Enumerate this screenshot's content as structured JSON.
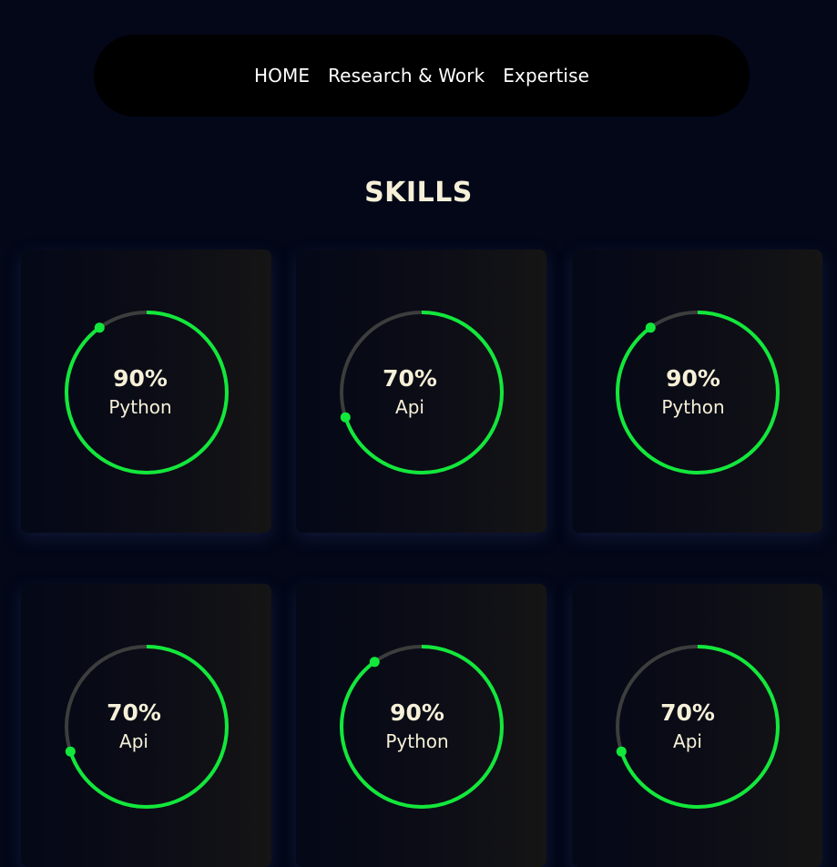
{
  "nav": {
    "items": [
      "HOME",
      "Research & Work",
      "Expertise"
    ]
  },
  "section": {
    "title": "SKILLS"
  },
  "colors": {
    "progress": "#12e83b",
    "track": "#3b3e3c",
    "text": "#f6f0d8",
    "background": "#030718"
  },
  "skills": [
    {
      "percent_label": "90%",
      "name": "Python",
      "value": 0.9
    },
    {
      "percent_label": "70%",
      "name": "Api",
      "value": 0.7
    },
    {
      "percent_label": "90%",
      "name": "Python",
      "value": 0.9
    },
    {
      "percent_label": "70%",
      "name": "Api",
      "value": 0.7
    },
    {
      "percent_label": "90%",
      "name": "Python",
      "value": 0.9
    },
    {
      "percent_label": "70%",
      "name": "Api",
      "value": 0.7
    }
  ]
}
